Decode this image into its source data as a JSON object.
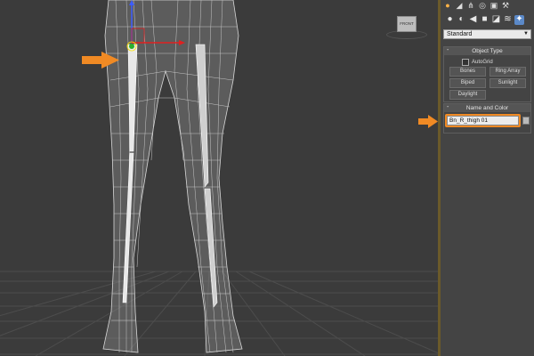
{
  "panel": {
    "dropdown_value": "Standard",
    "object_type": {
      "title": "Object Type",
      "autogrid_label": "AutoGrid",
      "buttons": [
        "Bones",
        "Ring Array",
        "Biped",
        "Sunlight",
        "Daylight"
      ]
    },
    "name_and_color": {
      "title": "Name and Color",
      "name_value": "Bn_R_thigh 01"
    },
    "minus_glyph": "-"
  },
  "viewport": {
    "viewcube_label": "FRONT"
  },
  "colors": {
    "annotation_arrow": "#f08a24",
    "panel_bg": "#444444",
    "viewport_bg": "#3b3b3b",
    "active_icon": "#5b89c8"
  },
  "icons": {
    "tabs": [
      "sun-icon",
      "bend-icon",
      "hierarchy-icon",
      "motion-icon",
      "display-icon",
      "wrench-icon"
    ],
    "categories": [
      "geometry-icon",
      "shapes-icon",
      "lights-icon",
      "cameras-icon",
      "helpers-icon",
      "spacewarps-icon",
      "systems-icon"
    ]
  }
}
